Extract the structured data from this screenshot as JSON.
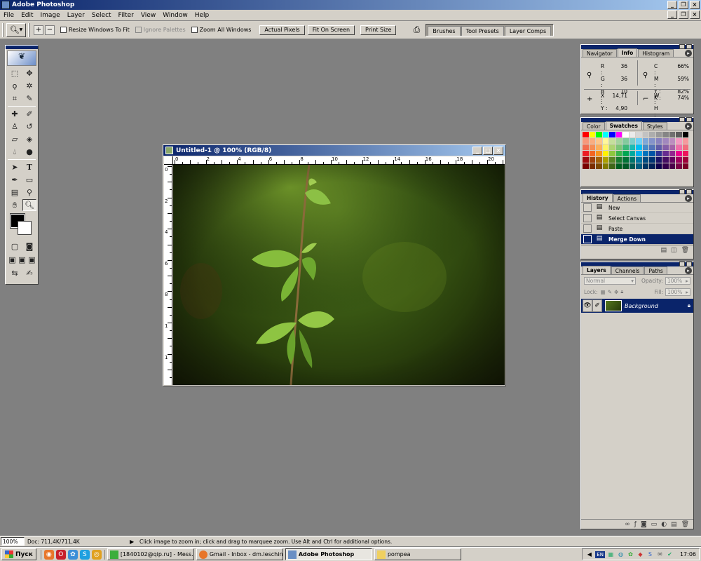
{
  "app": {
    "title": "Adobe Photoshop"
  },
  "menu": [
    "File",
    "Edit",
    "Image",
    "Layer",
    "Select",
    "Filter",
    "View",
    "Window",
    "Help"
  ],
  "options": {
    "resize_windows": "Resize Windows To Fit",
    "ignore_palettes": "Ignore Palettes",
    "zoom_all": "Zoom All Windows",
    "actual_pixels": "Actual Pixels",
    "fit_on_screen": "Fit On Screen",
    "print_size": "Print Size",
    "well_tabs": [
      "Brushes",
      "Tool Presets",
      "Layer Comps"
    ]
  },
  "document": {
    "title": "Untitled-1 @ 100% (RGB/8)",
    "ruler_h": [
      "0",
      "2",
      "4",
      "6",
      "8",
      "10",
      "12",
      "14",
      "16",
      "18",
      "20"
    ],
    "ruler_v": [
      "0",
      "2",
      "4",
      "6",
      "8",
      "1",
      "1",
      "1"
    ]
  },
  "info_panel": {
    "tabs": [
      "Navigator",
      "Info",
      "Histogram"
    ],
    "R": "36",
    "G": "36",
    "B": "10",
    "C": "66%",
    "M": "59%",
    "Y": "82%",
    "K": "74%",
    "X": "14,71",
    "Yc": "4,90",
    "W": "",
    "H": ""
  },
  "swatches_panel": {
    "tabs": [
      "Color",
      "Swatches",
      "Styles"
    ],
    "colors": [
      "#ff0000",
      "#ffff00",
      "#00ff00",
      "#00ffff",
      "#0000ff",
      "#ff00ff",
      "#ffffff",
      "#ebebeb",
      "#d6d6d6",
      "#c2c2c2",
      "#adadad",
      "#999999",
      "#858585",
      "#707070",
      "#5c5c5c",
      "#000000",
      "#f7977a",
      "#f9ad81",
      "#fdc68a",
      "#fff79a",
      "#c4df9b",
      "#a2d39c",
      "#82ca9d",
      "#7bcdc8",
      "#6ecff6",
      "#7ea7d8",
      "#8493ca",
      "#8882be",
      "#a187be",
      "#bc8dbf",
      "#f49ac2",
      "#f6989d",
      "#f26c4f",
      "#f68e55",
      "#fbaf5c",
      "#fff467",
      "#acd372",
      "#7cc576",
      "#3bb878",
      "#1abbb4",
      "#00bff3",
      "#438ccb",
      "#5574b9",
      "#605ca8",
      "#855fa8",
      "#a763a8",
      "#f06ea9",
      "#f26d7d",
      "#ed1c24",
      "#f26522",
      "#f7941d",
      "#fff200",
      "#8dc73f",
      "#39b54a",
      "#00a651",
      "#00a99d",
      "#00aeef",
      "#0072bc",
      "#0054a6",
      "#2e3192",
      "#662d91",
      "#92278f",
      "#ec008c",
      "#ed145b",
      "#9e0b0f",
      "#a0410d",
      "#a36209",
      "#aba000",
      "#598527",
      "#1a7b30",
      "#007236",
      "#00746b",
      "#0076a3",
      "#004b80",
      "#003471",
      "#1b1464",
      "#440e62",
      "#630460",
      "#9e005d",
      "#9e0039",
      "#790000",
      "#7b2e00",
      "#7d4900",
      "#827b00",
      "#406618",
      "#005e20",
      "#005826",
      "#005952",
      "#005b7f",
      "#003663",
      "#002157",
      "#0d004c",
      "#32004b",
      "#4b0049",
      "#7b0046",
      "#7a0026"
    ]
  },
  "history_panel": {
    "tabs": [
      "History",
      "Actions"
    ],
    "items": [
      "New",
      "Select Canvas",
      "Paste",
      "Merge Down"
    ]
  },
  "layers_panel": {
    "tabs": [
      "Layers",
      "Channels",
      "Paths"
    ],
    "blend_mode": "Normal",
    "opacity_label": "Opacity:",
    "opacity": "100%",
    "lock_label": "Lock:",
    "fill_label": "Fill:",
    "fill": "100%",
    "layer_name": "Background"
  },
  "status": {
    "zoom": "100%",
    "doc": "Doc: 711,4K/711,4K",
    "hint": "Click image to zoom in; click and drag to marquee zoom.  Use Alt and Ctrl for additional options."
  },
  "taskbar": {
    "start": "Пуск",
    "tasks": [
      "[1840102@qip.ru] - Mess...",
      "Gmail - Inbox - dm.leschin...",
      "Adobe Photoshop",
      "pompea"
    ],
    "lang": "EN",
    "clock": "17:06"
  }
}
